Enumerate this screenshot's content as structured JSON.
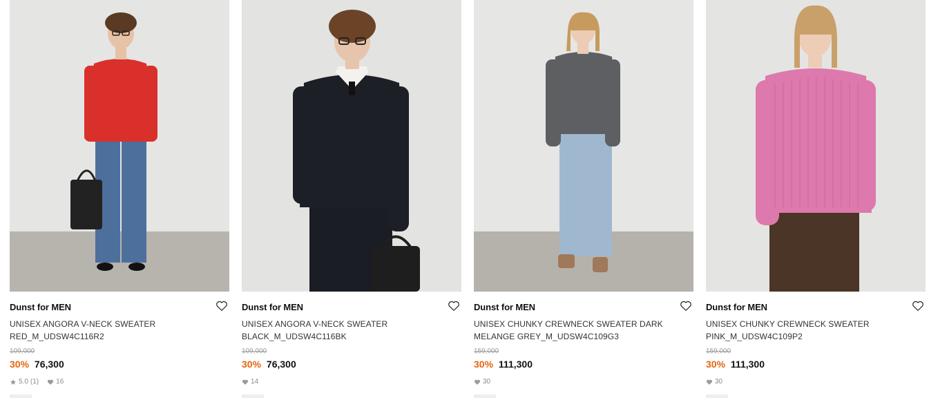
{
  "products": [
    {
      "brand": "Dunst for MEN",
      "name": "UNISEX ANGORA V-NECK SWEATER RED_M_UDSW4C116R2",
      "original_price": "109,000",
      "discount": "30%",
      "sale_price": "76,300",
      "rating": "5.0",
      "review_count": "(1)",
      "likes": "16",
      "sweater_color": "#d9302c",
      "pants_color": "#4d6f9c",
      "hair_color": "#5a3a22",
      "image_desc_icon": "model-photo"
    },
    {
      "brand": "Dunst for MEN",
      "name": "UNISEX ANGORA V-NECK SWEATER BLACK_M_UDSW4C116BK",
      "original_price": "109,000",
      "discount": "30%",
      "sale_price": "76,300",
      "likes": "14",
      "sweater_color": "#1c1f26",
      "pants_color": "#1a1d24",
      "hair_color": "#6b4428"
    },
    {
      "brand": "Dunst for MEN",
      "name": "UNISEX CHUNKY CREWNECK SWEATER DARK MELANGE GREY_M_UDSW4C109G3",
      "original_price": "159,000",
      "discount": "30%",
      "sale_price": "111,300",
      "likes": "30",
      "sweater_color": "#5d5f63",
      "pants_color": "#9fb8cf",
      "hair_color": "#c79a5e"
    },
    {
      "brand": "Dunst for MEN",
      "name": "UNISEX CHUNKY CREWNECK SWEATER PINK_M_UDSW4C109P2",
      "original_price": "159,000",
      "discount": "30%",
      "sale_price": "111,300",
      "likes": "30",
      "sweater_color": "#dd79ad",
      "pants_color": "#4a3526",
      "hair_color": "#c9a06a"
    }
  ],
  "colors": {
    "discount": "#e8640c",
    "wall": "#e6e6e4",
    "floor": "#b4b1aa"
  }
}
